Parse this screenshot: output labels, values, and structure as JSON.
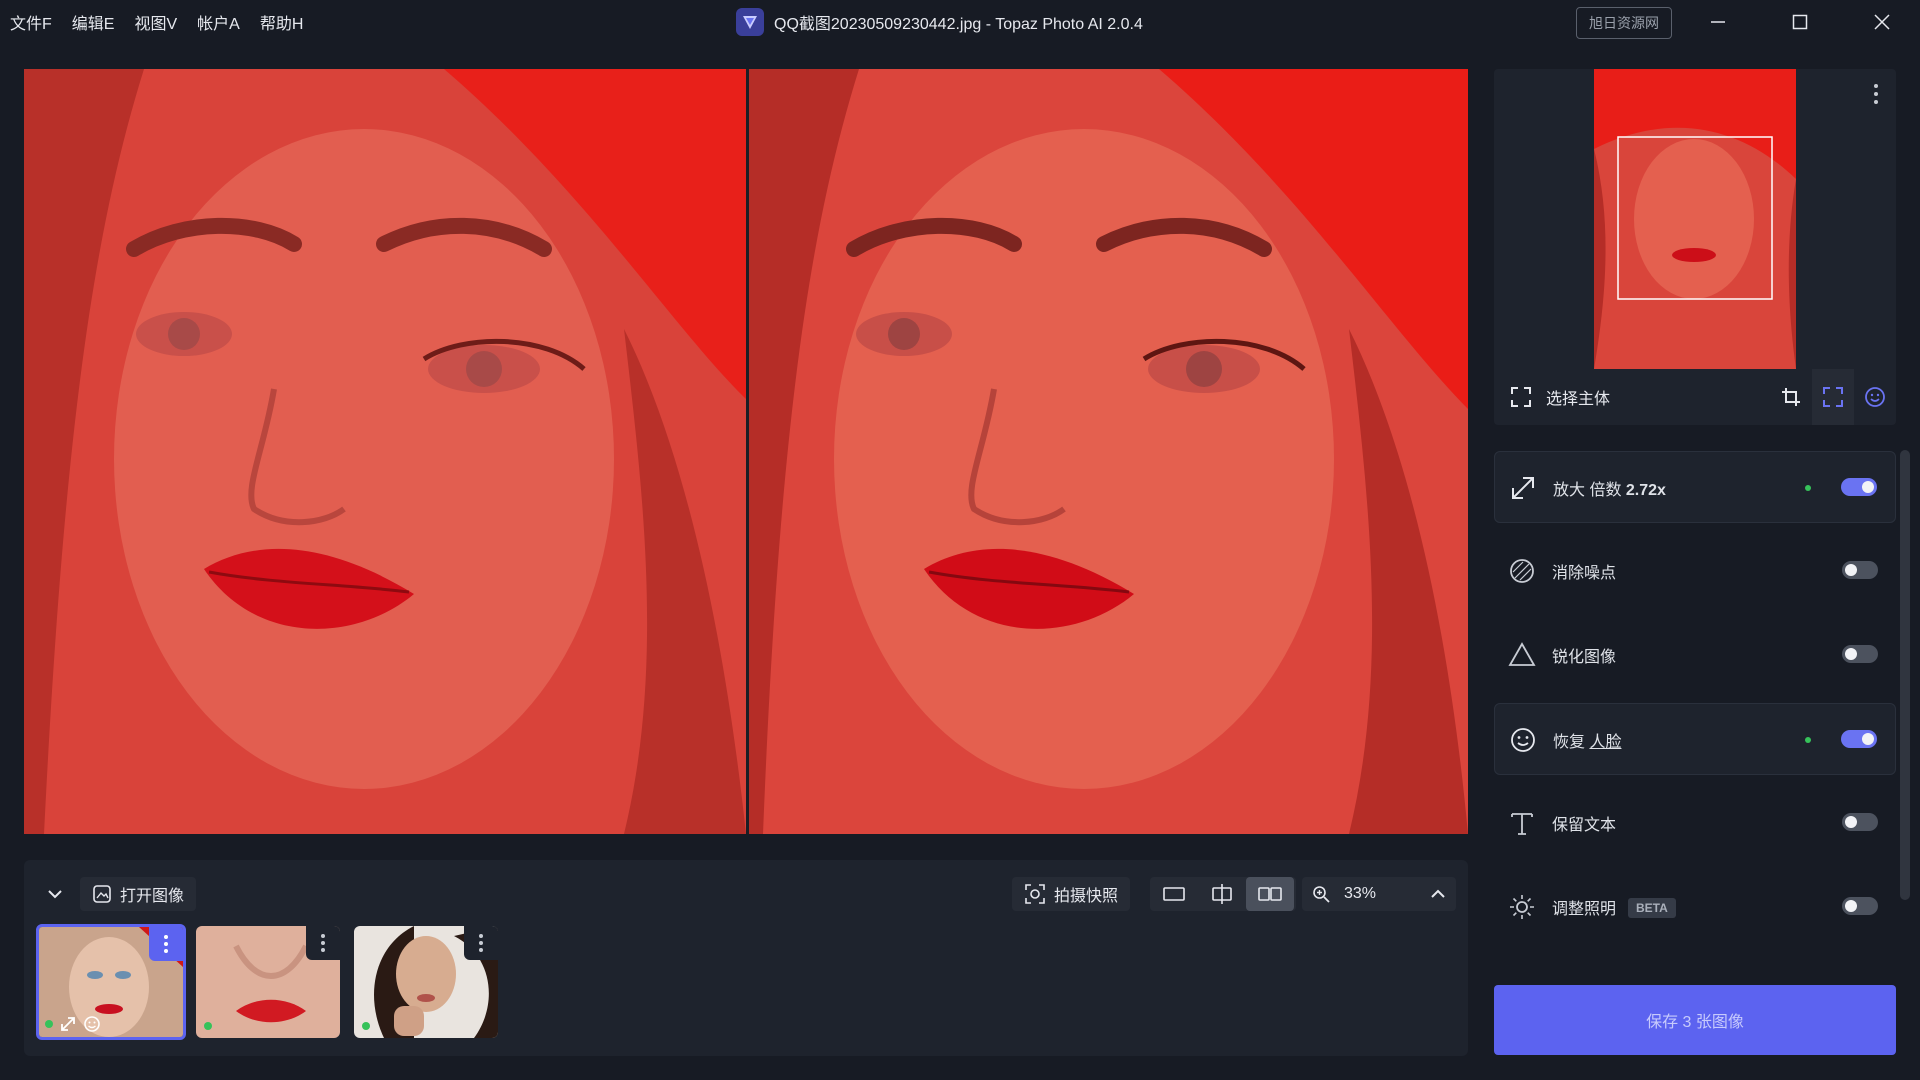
{
  "menu": [
    "文件F",
    "编辑E",
    "视图V",
    "帐户A",
    "帮助H"
  ],
  "window": {
    "title": "QQ截图20230509230442.jpg - Topaz Photo AI 2.0.4",
    "badge": "旭日资源网"
  },
  "navigator": {
    "select_subject_label": "选择主体"
  },
  "filmstrip": {
    "open_image_label": "打开图像",
    "snapshot_label": "拍摄快照",
    "zoom": "33%"
  },
  "enhancements": [
    {
      "label": "放大 倍数",
      "value": "2.72x",
      "on": true,
      "icon": "upscale-icon"
    },
    {
      "label": "消除噪点",
      "on": false,
      "icon": "denoise-icon"
    },
    {
      "label": "锐化图像",
      "on": false,
      "icon": "sharpen-icon"
    },
    {
      "label_prefix": "恢复 ",
      "label_link": "人脸",
      "on": true,
      "icon": "face-icon"
    },
    {
      "label": "保留文本",
      "on": false,
      "icon": "text-icon"
    },
    {
      "label": "调整照明",
      "badge": "BETA",
      "on": false,
      "icon": "light-icon"
    }
  ],
  "save_label": "保存 3 张图像",
  "colors": {
    "accent": "#5c63f0",
    "toggle_on": "#6a73f2",
    "status_dot": "#36c25a",
    "photo_tint": "#e8524a"
  }
}
